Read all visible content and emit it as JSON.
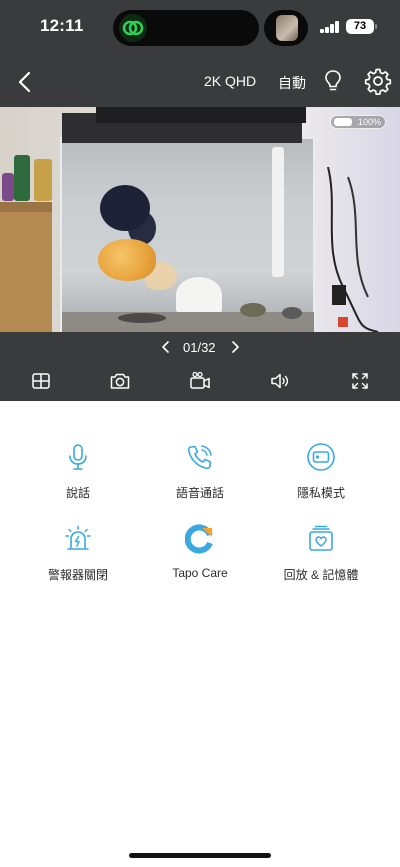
{
  "status_bar": {
    "time": "12:11",
    "battery": "73"
  },
  "nav": {
    "back_icon": "chevron-left-icon",
    "quality": "2K QHD",
    "mode": "自動",
    "light_icon": "lightbulb-icon",
    "settings_icon": "gear-icon"
  },
  "video": {
    "battery_overlay": "100%"
  },
  "pager": {
    "text": "01/32"
  },
  "toolbar": [
    {
      "icon": "grid-layout-icon"
    },
    {
      "icon": "camera-icon"
    },
    {
      "icon": "video-record-icon"
    },
    {
      "icon": "speaker-icon"
    },
    {
      "icon": "fullscreen-icon"
    }
  ],
  "controls": [
    {
      "label": "說話",
      "icon": "microphone-icon"
    },
    {
      "label": "語音通話",
      "icon": "phone-call-icon"
    },
    {
      "label": "隱私模式",
      "icon": "privacy-camera-icon"
    },
    {
      "label": "警報器關閉",
      "icon": "alarm-siren-icon"
    },
    {
      "label": "Tapo Care",
      "icon": "tapo-care-logo-icon"
    },
    {
      "label": "回放 & 記憶體",
      "icon": "playback-memory-icon"
    }
  ],
  "colors": {
    "top_panel": "#3a3b3d",
    "accent": "#3aa9e0",
    "tapo_care_orange": "#f5a623"
  }
}
